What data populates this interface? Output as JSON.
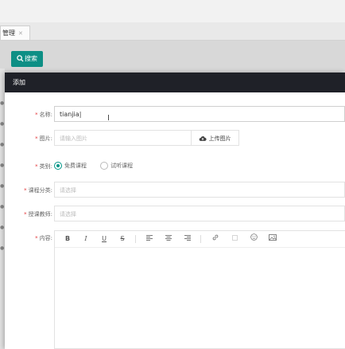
{
  "tabs": [
    {
      "label": "管理"
    }
  ],
  "toolbar": {
    "search_label": "搜索"
  },
  "modal": {
    "title": "添加",
    "fields": {
      "name": {
        "label": "名称:",
        "value": "tianjia"
      },
      "image": {
        "label": "图片:",
        "placeholder": "请输入图片",
        "upload_label": "上传图片"
      },
      "category": {
        "label": "类别:",
        "options": [
          "免费课程",
          "试听课程"
        ],
        "selected": "免费课程"
      },
      "course_type": {
        "label": "课程分类:",
        "placeholder": "请选择"
      },
      "teacher": {
        "label": "授课教师:",
        "placeholder": "请选择"
      },
      "content": {
        "label": "内容:"
      }
    },
    "editor_tools": [
      "B",
      "I",
      "U",
      "S",
      "align-left-icon",
      "align-center-icon",
      "align-right-icon",
      "link-icon",
      "unlink-icon",
      "emoji-icon",
      "image-icon"
    ]
  },
  "colors": {
    "accent": "#009688",
    "header": "#1f2128",
    "required": "#e4393c"
  }
}
